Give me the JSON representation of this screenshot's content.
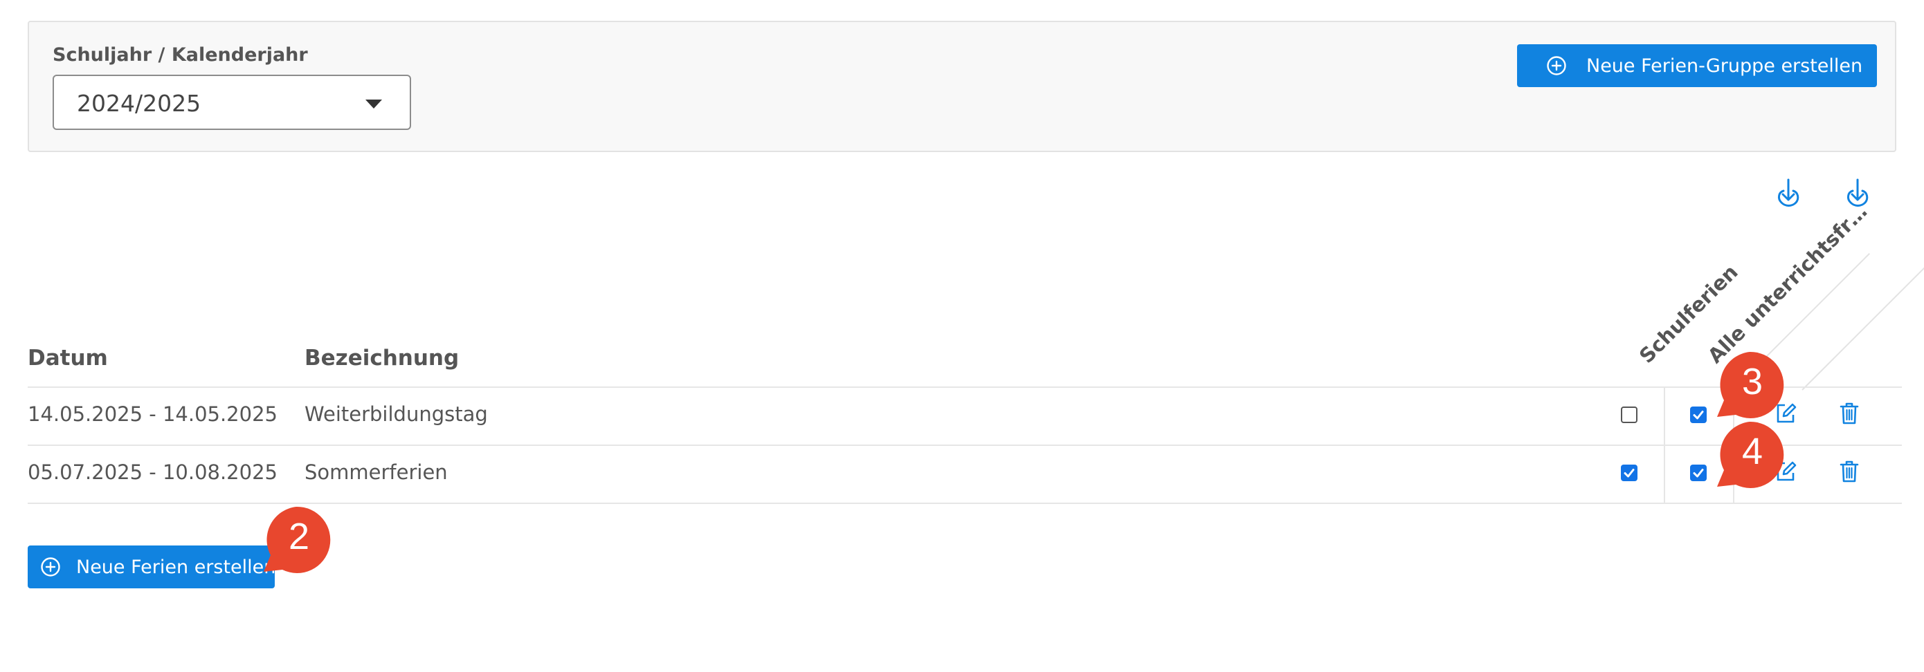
{
  "filter": {
    "label": "Schuljahr / Kalenderjahr",
    "selected_year": "2024/2025"
  },
  "buttons": {
    "new_group": "Neue Ferien-Gruppe erstellen",
    "new_holiday": "Neue Ferien erstellen"
  },
  "table": {
    "headers": {
      "datum": "Datum",
      "bezeichnung": "Bezeichnung",
      "schulferien": "Schulferien",
      "alle": "Alle unterrichtsfr…"
    },
    "rows": [
      {
        "datum": "14.05.2025 - 14.05.2025",
        "bezeichnung": "Weiterbildungstag",
        "schulferien": false,
        "alle": true
      },
      {
        "datum": "05.07.2025 - 10.08.2025",
        "bezeichnung": "Sommerferien",
        "schulferien": true,
        "alle": true
      }
    ]
  },
  "callouts": {
    "b2": "2",
    "b3": "3",
    "b4": "4"
  },
  "colors": {
    "accent": "#1183e0",
    "badge": "#e8472e",
    "checkbox": "#1273e6"
  },
  "icons": {
    "plus": "plus-circle-icon",
    "download": "download-icon",
    "edit": "edit-icon",
    "delete": "trash-icon"
  }
}
